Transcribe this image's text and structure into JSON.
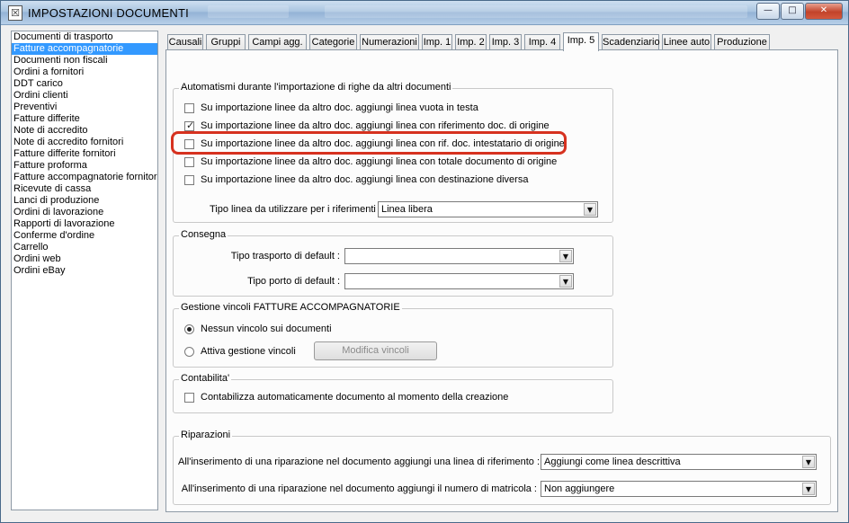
{
  "window": {
    "title": "IMPOSTAZIONI DOCUMENTI",
    "minimize": "—",
    "maximize": "□",
    "close": "✕"
  },
  "doc_list": [
    "Documenti di trasporto",
    "Fatture accompagnatorie",
    "Documenti non fiscali",
    "Ordini a fornitori",
    "DDT carico",
    "Ordini clienti",
    "Preventivi",
    "Fatture differite",
    "Note di accredito",
    "Note di accredito fornitori",
    "Fatture differite fornitori",
    "Fatture proforma",
    "Fatture accompagnatorie fornitori",
    "Ricevute di cassa",
    "Lanci di produzione",
    "Ordini di lavorazione",
    "Rapporti di lavorazione",
    "Conferme d'ordine",
    "Carrello",
    "Ordini web",
    "Ordini eBay"
  ],
  "selected_doc": "Fatture accompagnatorie",
  "tabs": [
    "Causali",
    "Gruppi",
    "Campi agg.",
    "Categorie",
    "Numerazioni",
    "Imp. 1",
    "Imp. 2",
    "Imp. 3",
    "Imp. 4",
    "Imp. 5",
    "Scadenziario",
    "Linee auto",
    "Produzione"
  ],
  "active_tab": "Imp. 5",
  "automatismi": {
    "legend": "Automatismi durante l'importazione di righe da altri documenti",
    "options": [
      {
        "label": "Su importazione linee da altro doc. aggiungi linea vuota in testa",
        "checked": false
      },
      {
        "label": "Su importazione linee da altro doc. aggiungi linea con riferimento doc. di origine",
        "checked": true
      },
      {
        "label": "Su importazione linee da altro doc. aggiungi linea con rif. doc. intestatario di origine",
        "checked": false
      },
      {
        "label": "Su importazione linee da altro doc. aggiungi linea con totale documento di origine",
        "checked": false
      },
      {
        "label": "Su importazione linee da altro doc. aggiungi linea con destinazione diversa",
        "checked": false
      }
    ],
    "tipo_linea_label": "Tipo linea da utilizzare per i riferimenti :",
    "tipo_linea_value": "Linea libera"
  },
  "consegna": {
    "legend": "Consegna",
    "trasporto_label": "Tipo trasporto di default :",
    "trasporto_value": "",
    "porto_label": "Tipo porto di default :",
    "porto_value": ""
  },
  "vincoli": {
    "legend": "Gestione vincoli FATTURE ACCOMPAGNATORIE",
    "option_none": "Nessun vincolo sui documenti",
    "option_active": "Attiva gestione vincoli",
    "selected": "Nessun vincolo sui documenti",
    "modify_button": "Modifica vincoli"
  },
  "contabilita": {
    "legend": "Contabilita'",
    "option": "Contabilizza automaticamente documento al momento della creazione",
    "checked": false
  },
  "riparazioni": {
    "legend": "Riparazioni",
    "riferimento_label": "All'inserimento di una riparazione nel documento aggiungi una linea di riferimento :",
    "riferimento_value": "Aggiungi come linea descrittiva",
    "matricola_label": "All'inserimento di una riparazione nel documento aggiungi il numero di matricola :",
    "matricola_value": "Non aggiungere"
  },
  "colors": {
    "highlight": "#d6311f",
    "selection": "#3399ff"
  },
  "icons": {
    "app": "document-icon",
    "dropdown": "chevron-down-icon",
    "check": "checkmark-icon"
  }
}
